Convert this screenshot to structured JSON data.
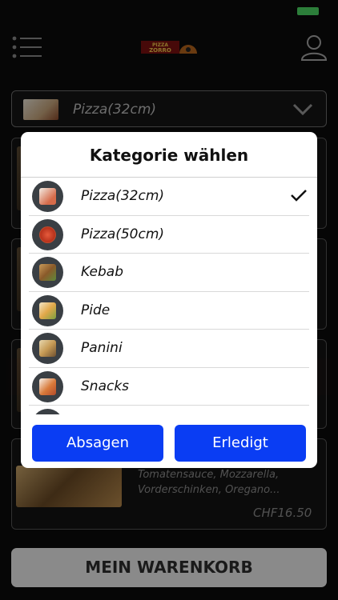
{
  "header": {
    "logo_text": "PIZZA ZORRO",
    "menu_icon": "hamburger-menu-icon",
    "user_icon": "user-icon"
  },
  "category_select": {
    "value": "Pizza(32cm)"
  },
  "background_card": {
    "description": "Tomatensauce, Mozzarella, Vorderschinken, Oregano...",
    "price": "CHF16.50"
  },
  "cart_button": {
    "label": "MEIN WARENKORB"
  },
  "modal": {
    "title": "Kategorie wählen",
    "options": [
      {
        "label": "Pizza(32cm)",
        "selected": true
      },
      {
        "label": "Pizza(50cm)",
        "selected": false
      },
      {
        "label": "Kebab",
        "selected": false
      },
      {
        "label": "Pide",
        "selected": false
      },
      {
        "label": "Panini",
        "selected": false
      },
      {
        "label": "Snacks",
        "selected": false
      }
    ],
    "cancel_label": "Absagen",
    "done_label": "Erledigt"
  },
  "colors": {
    "accent_button": "#0a3df3",
    "battery": "#4cd964",
    "background": "#0b0b0b"
  }
}
